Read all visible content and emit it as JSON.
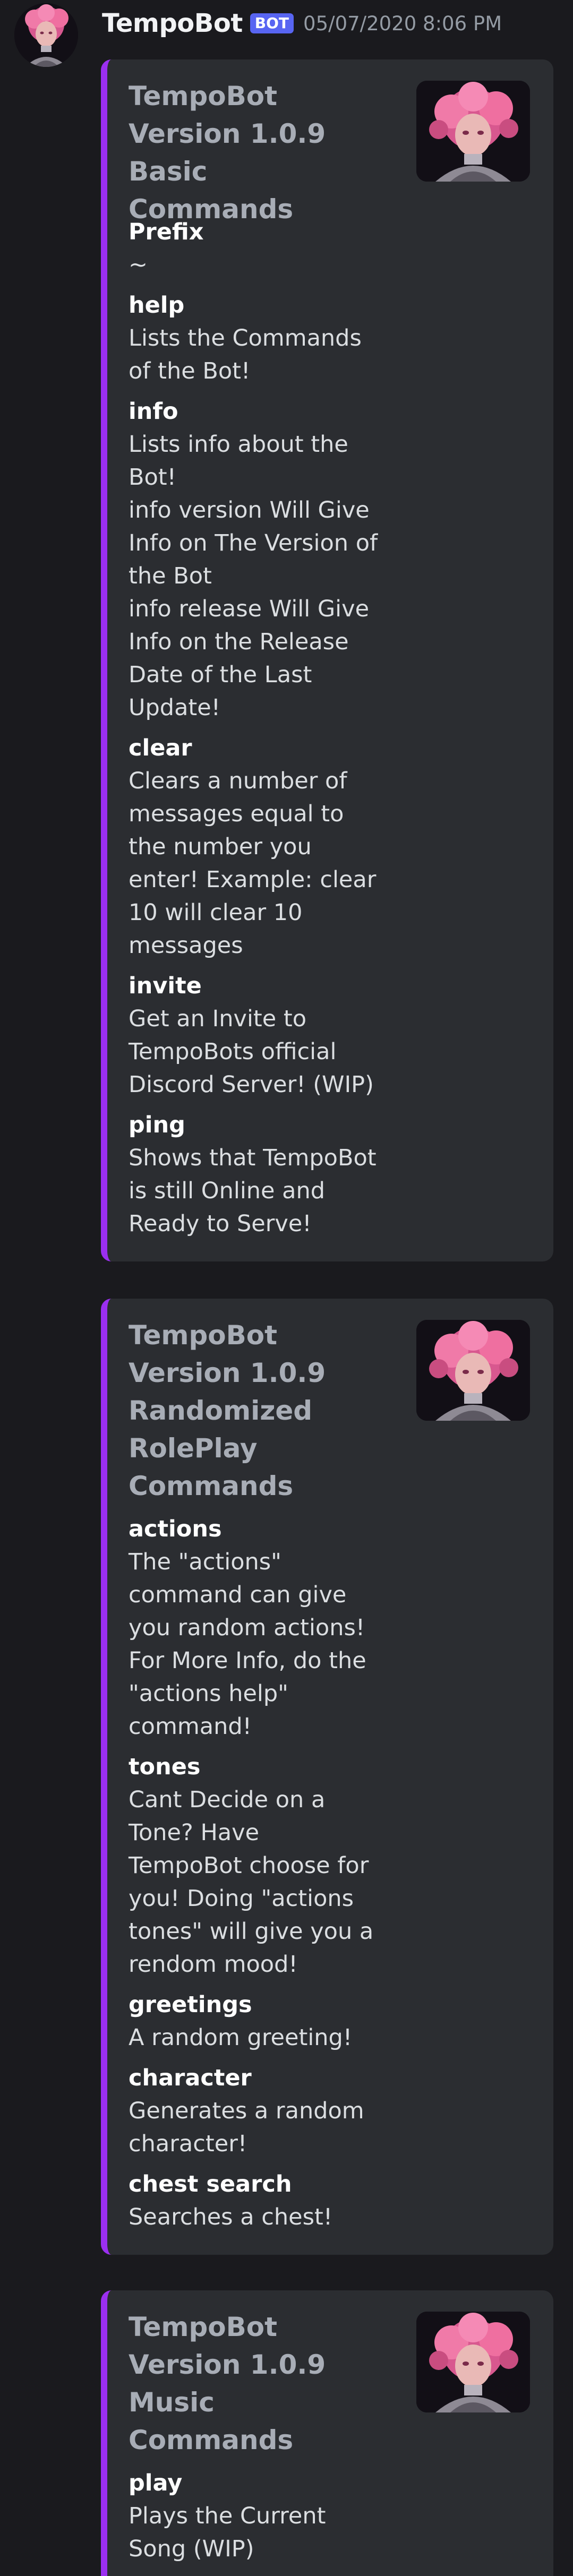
{
  "message": {
    "username": "TempoBot",
    "bot_tag": "BOT",
    "timestamp": "05/07/2020 8:06 PM",
    "avatar_icon": "anime-girl-avatar-icon",
    "accent_color": "#9b2ff0"
  },
  "embeds": [
    {
      "title": "TempoBot Version 1.0.9 Basic Commands",
      "fields": [
        {
          "name": "Prefix",
          "value": "~"
        },
        {
          "name": "help",
          "value": "Lists the Commands of the Bot!"
        },
        {
          "name": "info",
          "value": "Lists info about the Bot!\n info version Will Give Info on The Version of the Bot\n info release Will Give Info on the Release Date of the Last Update!"
        },
        {
          "name": "clear",
          "value": "Clears a number of messages equal to the number you enter! Example: clear 10 will clear 10 messages"
        },
        {
          "name": "invite",
          "value": "Get an Invite to TempoBots official Discord Server! (WIP)"
        },
        {
          "name": "ping",
          "value": "Shows that TempoBot is still Online and Ready to Serve!"
        }
      ]
    },
    {
      "title": "TempoBot Version 1.0.9 Randomized RolePlay Commands",
      "fields": [
        {
          "name": "actions",
          "value": "The \"actions\" command can give you random actions!\n For More Info, do the \"actions help\" command!"
        },
        {
          "name": "tones",
          "value": "Cant Decide on a Tone? Have TempoBot choose for you! Doing \"actions tones\" will give you a rendom mood!"
        },
        {
          "name": "greetings",
          "value": "A random greeting!"
        },
        {
          "name": "character",
          "value": "Generates a random character!"
        },
        {
          "name": "chest search",
          "value": "Searches a chest!"
        }
      ]
    },
    {
      "title": "TempoBot Version 1.0.9 Music Commands",
      "fields": [
        {
          "name": "play",
          "value": "Plays the Current Song (WIP)"
        }
      ]
    }
  ]
}
